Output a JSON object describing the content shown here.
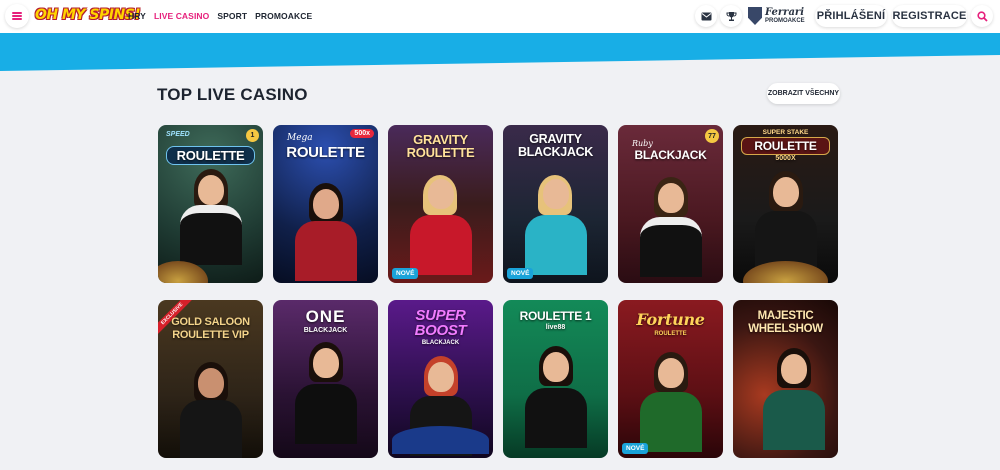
{
  "header": {
    "logo": "OH MY SPINS!",
    "nav": [
      {
        "label": "HRY",
        "active": false
      },
      {
        "label": "LIVE CASINO",
        "active": true
      },
      {
        "label": "SPORT",
        "active": false
      },
      {
        "label": "PROMOAKCE",
        "active": false
      }
    ],
    "promo_brand": "Ferrari",
    "promo_sub": "PROMOAKCE",
    "login_label": "PŘIHLÁŠENÍ",
    "register_label": "REGISTRACE",
    "icons": [
      "menu-icon",
      "mail-icon",
      "trophy-icon",
      "shield-icon",
      "search-icon"
    ],
    "accent_color": "#e6207c",
    "banner_color": "#18aee6"
  },
  "section": {
    "title": "TOP LIVE CASINO",
    "show_all_label": "ZOBRAZIT VŠECHNY"
  },
  "games": [
    {
      "title": "ROULETTE",
      "pre": "SPEED",
      "badge": "1",
      "new": false,
      "bg": "#1f3b33"
    },
    {
      "title": "ROULETTE",
      "pre": "Mega",
      "badge": "500x",
      "new": false,
      "bg": "#10204a"
    },
    {
      "title": "GRAVITY ROULETTE",
      "pre": "",
      "badge": "",
      "new": true,
      "new_label": "NOVÉ",
      "bg": "#3a1c1c"
    },
    {
      "title": "GRAVITY BLACKJACK",
      "pre": "",
      "badge": "",
      "new": true,
      "new_label": "NOVÉ",
      "bg": "#1c2533"
    },
    {
      "title": "BLACKJACK",
      "pre": "Ruby",
      "badge": "77",
      "new": false,
      "bg": "#4a1820"
    },
    {
      "title": "ROULETTE",
      "pre": "SUPER STAKE",
      "badge": "",
      "sub": "5000X",
      "new": false,
      "bg": "#1a1a1a"
    },
    {
      "title": "GOLD SALOON ROULETTE VIP",
      "pre": "",
      "badge": "",
      "ribbon": "EXCLUSIVE",
      "new": false,
      "bg": "#2e2418"
    },
    {
      "title": "ONE",
      "pre": "",
      "badge": "",
      "sub": "BLACKJACK",
      "new": false,
      "bg": "#2a1233"
    },
    {
      "title": "SUPER BOOST",
      "pre": "",
      "badge": "",
      "sub": "BLACKJACK",
      "new": false,
      "bg": "#2b0f4a"
    },
    {
      "title": "ROULETTE 1",
      "pre": "",
      "badge": "",
      "sub": "live88",
      "new": false,
      "bg": "#0f6e47"
    },
    {
      "title": "Fortune",
      "pre": "",
      "badge": "",
      "sub": "ROULETTE",
      "new": true,
      "new_label": "NOVÉ",
      "bg": "#5c0f14"
    },
    {
      "title": "MAJESTIC WHEELSHOW",
      "pre": "",
      "badge": "",
      "new": false,
      "bg": "#3a1612"
    }
  ]
}
